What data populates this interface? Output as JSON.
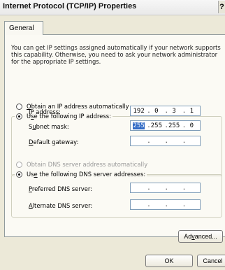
{
  "window": {
    "title": "Internet Protocol (TCP/IP) Properties",
    "help_glyph": "?"
  },
  "tabs": [
    {
      "label": "General"
    }
  ],
  "general": {
    "description": "You can get IP settings assigned automatically if your network supports this capability. Otherwise, you need to ask your network administrator for the appropriate IP settings.",
    "obtain_ip_auto": {
      "prefix": "",
      "mnemonic": "O",
      "rest": "btain an IP address automatically",
      "selected": false
    },
    "use_following_ip": {
      "prefix": "U",
      "mnemonic": "s",
      "rest": "e the following IP address:",
      "selected": true
    },
    "ip_address": {
      "mnemonic": "I",
      "rest": "P address:",
      "octets": [
        "192",
        "0",
        "3",
        "1"
      ]
    },
    "subnet_mask": {
      "prefix": "S",
      "mnemonic": "u",
      "rest": "bnet mask:",
      "octets": [
        "255",
        "255",
        "255",
        "0"
      ]
    },
    "default_gateway": {
      "mnemonic": "D",
      "rest": "efault gateway:",
      "octets": [
        "",
        "",
        "",
        ""
      ]
    },
    "obtain_dns_auto": {
      "mnemonic": "B",
      "rest": "Obtain DNS server address automatically",
      "label": "Obtain DNS server address automatically",
      "selected": false,
      "enabled": false
    },
    "use_following_dns": {
      "prefix": "Us",
      "mnemonic": "e",
      "rest": " the following DNS server addresses:",
      "selected": true
    },
    "preferred_dns": {
      "mnemonic": "P",
      "rest": "referred DNS server:",
      "octets": [
        "",
        "",
        "",
        ""
      ]
    },
    "alternate_dns": {
      "mnemonic": "A",
      "rest": "lternate DNS server:",
      "octets": [
        "",
        "",
        "",
        ""
      ]
    },
    "advanced": {
      "prefix": "Ad",
      "mnemonic": "v",
      "rest": "anced..."
    }
  },
  "footer": {
    "ok_label": "OK",
    "cancel_label": "Cancel"
  }
}
